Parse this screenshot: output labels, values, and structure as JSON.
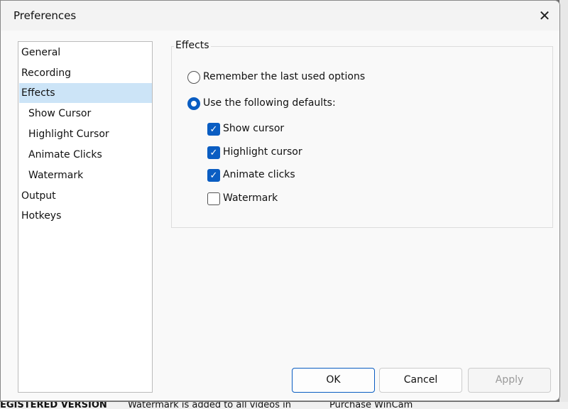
{
  "dialog": {
    "title": "Preferences",
    "close_icon": "close-icon"
  },
  "nav": {
    "items": [
      {
        "label": "General",
        "sub": false
      },
      {
        "label": "Recording",
        "sub": false
      },
      {
        "label": "Effects",
        "sub": false,
        "selected": true
      },
      {
        "label": "Show Cursor",
        "sub": true
      },
      {
        "label": "Highlight Cursor",
        "sub": true
      },
      {
        "label": "Animate Clicks",
        "sub": true
      },
      {
        "label": "Watermark",
        "sub": true
      },
      {
        "label": "Output",
        "sub": false
      },
      {
        "label": "Hotkeys",
        "sub": false
      }
    ]
  },
  "effects": {
    "group_label": "Effects",
    "radio_remember": {
      "label": "Remember the last used options",
      "checked": false
    },
    "radio_defaults": {
      "label": "Use the following defaults:",
      "checked": true
    },
    "checkboxes": [
      {
        "label": "Show cursor",
        "checked": true
      },
      {
        "label": "Highlight cursor",
        "checked": true
      },
      {
        "label": "Animate clicks",
        "checked": true
      },
      {
        "label": "Watermark",
        "checked": false
      }
    ]
  },
  "buttons": {
    "ok": "OK",
    "cancel": "Cancel",
    "apply": "Apply"
  },
  "background": {
    "status_left": "EGISTERED VERSION",
    "status_mid": "Watermark is added to all videos in",
    "status_right": "Purchase WinCam"
  },
  "colors": {
    "accent": "#0a5dc2",
    "selection": "#cce4f7"
  }
}
